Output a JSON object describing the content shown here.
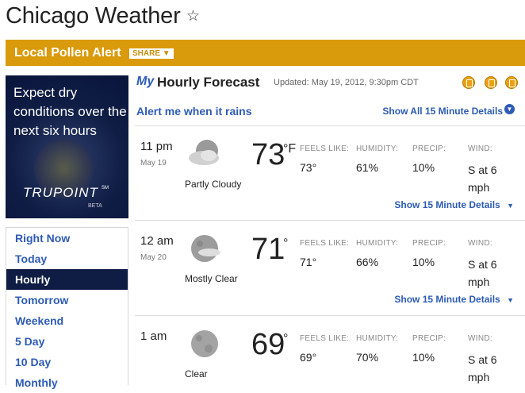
{
  "page": {
    "title": "Chicago Weather",
    "favorite_icon": "star-icon"
  },
  "alert_bar": {
    "text": "Local Pollen Alert",
    "share_label": "SHARE"
  },
  "promo": {
    "text": "Expect dry conditions over the next six hours",
    "logo": "TRUPOINT",
    "logo_sm": "SM",
    "beta": "BETA"
  },
  "nav": {
    "items": [
      {
        "label": "Right Now"
      },
      {
        "label": "Today"
      },
      {
        "label": "Hourly",
        "active": true
      },
      {
        "label": "Tomorrow"
      },
      {
        "label": "Weekend"
      },
      {
        "label": "5 Day"
      },
      {
        "label": "10 Day"
      },
      {
        "label": "Monthly"
      }
    ]
  },
  "forecast": {
    "my": "My",
    "title": "Hourly Forecast",
    "updated": "Updated: May 19, 2012, 9:30pm CDT",
    "alert_rain": "Alert me when it rains",
    "show_all": "Show All 15 Minute Details",
    "labels": {
      "feels": "FEELS LIKE:",
      "humidity": "HUMIDITY:",
      "precip": "PRECIP:",
      "wind": "WIND:"
    },
    "show15": "Show 15 Minute Details",
    "rows": [
      {
        "time": "11 pm",
        "date": "May 19",
        "condition": "Partly Cloudy",
        "icon": "partly-cloudy-night-icon",
        "temp": "73",
        "unit": "°F",
        "feels": "73°",
        "humidity": "61%",
        "precip": "10%",
        "wind": "S at 6 mph"
      },
      {
        "time": "12 am",
        "date": "May 20",
        "condition": "Mostly Clear",
        "icon": "mostly-clear-night-icon",
        "temp": "71",
        "unit": "°",
        "feels": "71°",
        "humidity": "66%",
        "precip": "10%",
        "wind": "S at 6 mph"
      },
      {
        "time": "1 am",
        "date": "",
        "condition": "Clear",
        "icon": "moon-icon",
        "temp": "69",
        "unit": "°",
        "feels": "69°",
        "humidity": "70%",
        "precip": "10%",
        "wind": "S at 6 mph"
      }
    ]
  },
  "colors": {
    "alert_bar": "#d99a0b",
    "link": "#2d5bb5",
    "nav_active": "#0f1d45"
  }
}
